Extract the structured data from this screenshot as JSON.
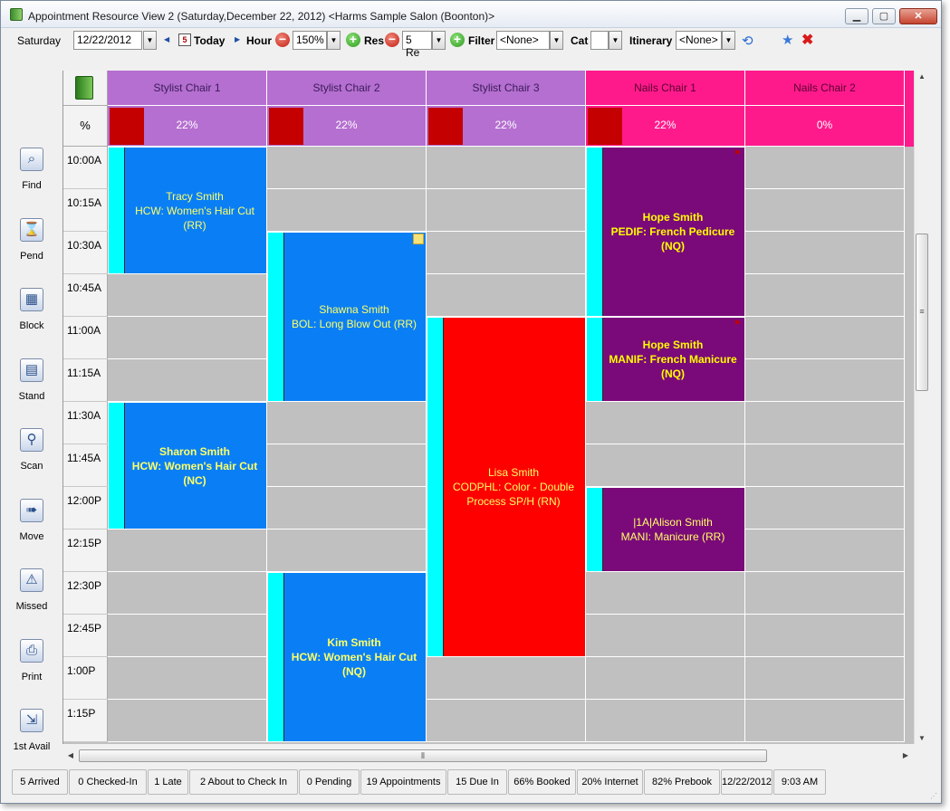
{
  "window": {
    "title": "Appointment Resource View 2 (Saturday,December 22, 2012) <Harms Sample Salon (Boonton)>",
    "minimize": "▁",
    "maximize": "▢",
    "close": "✕"
  },
  "toolbar": {
    "day": "Saturday",
    "date": "12/22/2012",
    "today": "Today",
    "hour_label": "Hour",
    "zoom": "150%",
    "res_label": "Res",
    "res_value": "5 Re",
    "filter_label": "Filter",
    "filter_value": "<None>",
    "cat_label": "Cat",
    "cat_value": "",
    "itinerary_label": "Itinerary",
    "itinerary_value": "<None>"
  },
  "sidebar": {
    "items": [
      {
        "label": "Find",
        "icon": "find-icon"
      },
      {
        "label": "Pend",
        "icon": "hourglass-icon"
      },
      {
        "label": "Block",
        "icon": "block-icon"
      },
      {
        "label": "Stand",
        "icon": "stand-icon"
      },
      {
        "label": "Scan",
        "icon": "scan-icon"
      },
      {
        "label": "Move",
        "icon": "move-icon"
      },
      {
        "label": "Missed",
        "icon": "missed-icon"
      },
      {
        "label": "Print",
        "icon": "printer-icon"
      },
      {
        "label": "1st Avail",
        "icon": "exit-icon"
      }
    ]
  },
  "grid": {
    "pct_header": "%",
    "resources": [
      {
        "name": "Stylist Chair 1",
        "pct": "22%",
        "color": "#b56fd0",
        "text_color": "#3a1a5a"
      },
      {
        "name": "Stylist Chair 2",
        "pct": "22%",
        "color": "#b56fd0",
        "text_color": "#3a1a5a"
      },
      {
        "name": "Stylist Chair 3",
        "pct": "22%",
        "color": "#b56fd0",
        "text_color": "#3a1a5a"
      },
      {
        "name": "Nails Chair 1",
        "pct": "22%",
        "color": "#ff1a8c",
        "text_color": "#5a0030"
      },
      {
        "name": "Nails Chair 2",
        "pct": "0%",
        "color": "#ff1a8c",
        "text_color": "#5a0030"
      }
    ],
    "times": [
      "10:00A",
      "10:15A",
      "10:30A",
      "10:45A",
      "11:00A",
      "11:15A",
      "11:30A",
      "11:45A",
      "12:00P",
      "12:15P",
      "12:30P",
      "12:45P",
      "1:00P",
      "1:15P"
    ],
    "appointments": [
      {
        "col": 0,
        "start": 0,
        "span": 3,
        "bg": "#0a7ff5",
        "fg": "#ffff66",
        "bold": false,
        "lines": [
          "Tracy Smith",
          "HCW: Women's Hair Cut",
          "(RR)"
        ],
        "marker": "none"
      },
      {
        "col": 0,
        "start": 6,
        "span": 3,
        "bg": "#0a7ff5",
        "fg": "#ffff66",
        "bold": true,
        "lines": [
          "Sharon Smith",
          "HCW: Women's Hair Cut",
          "(NC)"
        ],
        "marker": "none"
      },
      {
        "col": 1,
        "start": 2,
        "span": 4,
        "bg": "#0a7ff5",
        "fg": "#ffff66",
        "bold": false,
        "lines": [
          "Shawna Smith",
          "BOL: Long Blow Out (RR)"
        ],
        "marker": "note"
      },
      {
        "col": 1,
        "start": 10,
        "span": 4,
        "bg": "#0a7ff5",
        "fg": "#ffff66",
        "bold": true,
        "lines": [
          "Kim Smith",
          "HCW: Women's Hair Cut",
          "(NQ)"
        ],
        "marker": "none"
      },
      {
        "col": 2,
        "start": 4,
        "span": 8,
        "bg": "#ff0000",
        "fg": "#ffff66",
        "bold": false,
        "lines": [
          "Lisa Smith",
          "CODPHL: Color - Double",
          "Process SP/H (RN)"
        ],
        "marker": "none"
      },
      {
        "col": 3,
        "start": 0,
        "span": 4,
        "bg": "#7a0a7a",
        "fg": "#ffff00",
        "bold": true,
        "lines": [
          "Hope Smith",
          "PEDIF: French Pedicure",
          "(NQ)"
        ],
        "marker": "flag"
      },
      {
        "col": 3,
        "start": 4,
        "span": 2,
        "bg": "#7a0a7a",
        "fg": "#ffff00",
        "bold": true,
        "lines": [
          "Hope Smith",
          "MANIF: French Manicure",
          "(NQ)"
        ],
        "marker": "flag"
      },
      {
        "col": 3,
        "start": 8,
        "span": 2,
        "bg": "#7a0a7a",
        "fg": "#ffff66",
        "bold": false,
        "lines": [
          "|1A|Alison Smith",
          "MANI: Manicure (RR)"
        ],
        "marker": "none"
      }
    ]
  },
  "status": [
    "5 Arrived",
    "0 Checked-In",
    "1 Late",
    "2 About to Check In",
    "0 Pending",
    "19 Appointments",
    "15 Due In",
    "66% Booked",
    "20% Internet",
    "82% Prebook",
    "12/22/2012",
    "9:03 AM"
  ]
}
